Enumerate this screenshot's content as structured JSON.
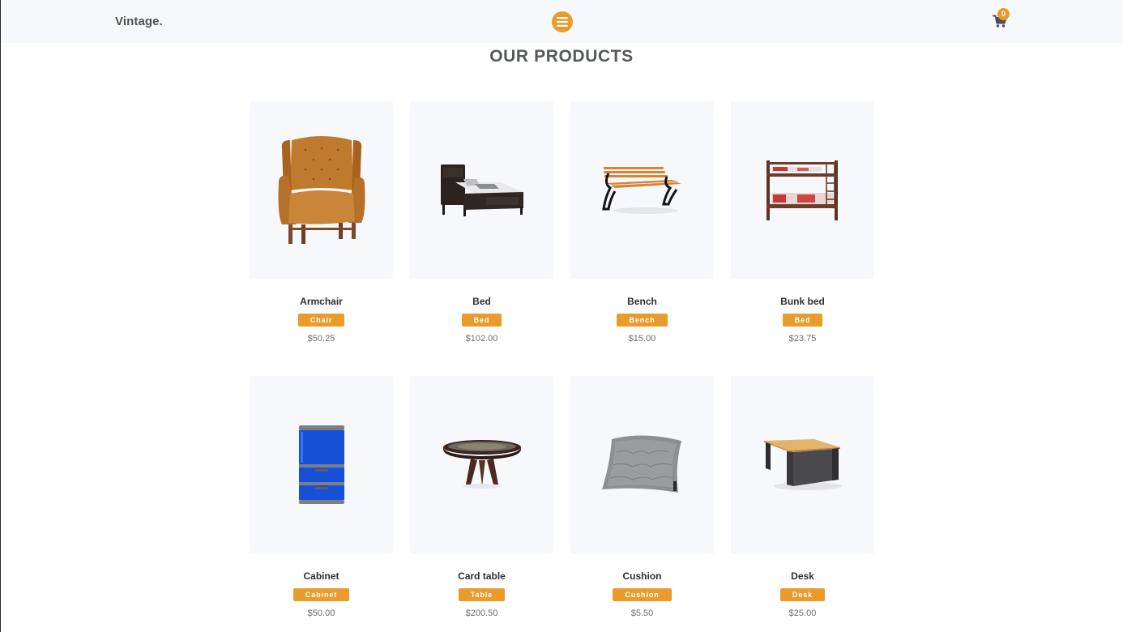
{
  "brand": "Vintage.",
  "cart": {
    "count": "0"
  },
  "section": {
    "title": "OUR PRODUCTS"
  },
  "colors": {
    "accent": "#e99b2b",
    "band": "#f7f8fb",
    "text": "#2d2f33"
  },
  "products": [
    {
      "name": "Armchair",
      "tag": "Chair",
      "price": "$50.25",
      "icon": "armchair-image"
    },
    {
      "name": "Bed",
      "tag": "Bed",
      "price": "$102.00",
      "icon": "bed-image"
    },
    {
      "name": "Bench",
      "tag": "Bench",
      "price": "$15.00",
      "icon": "bench-image"
    },
    {
      "name": "Bunk bed",
      "tag": "Bed",
      "price": "$23.75",
      "icon": "bunk-bed-image"
    },
    {
      "name": "Cabinet",
      "tag": "Cabinet",
      "price": "$50.00",
      "icon": "cabinet-image"
    },
    {
      "name": "Card table",
      "tag": "Table",
      "price": "$200.50",
      "icon": "card-table-image"
    },
    {
      "name": "Cushion",
      "tag": "Cushion",
      "price": "$5.50",
      "icon": "cushion-image"
    },
    {
      "name": "Desk",
      "tag": "Desk",
      "price": "$25.00",
      "icon": "desk-image"
    }
  ]
}
